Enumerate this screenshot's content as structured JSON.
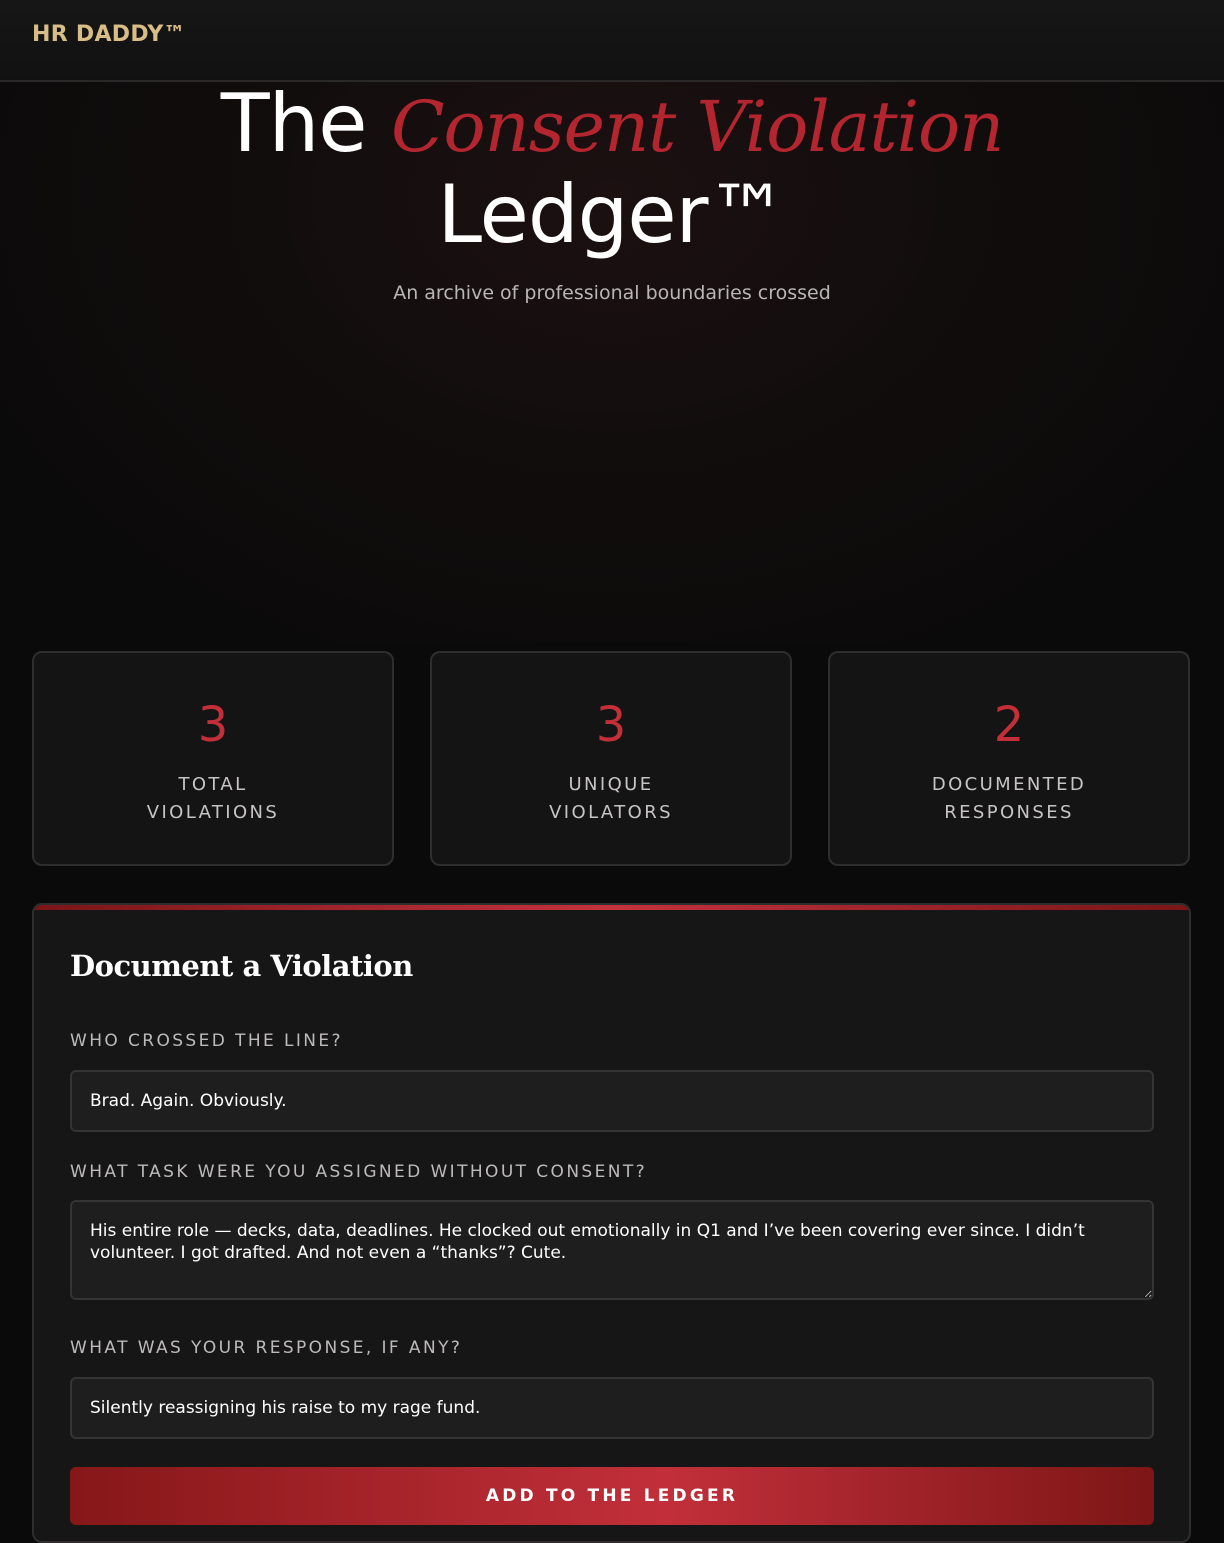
{
  "nav": {
    "brand": "HR DADDY™"
  },
  "hero": {
    "title_prefix": "The",
    "title_accent": "Consent Violation",
    "title_suffix": "Ledger™",
    "subtitle": "An archive of professional boundaries crossed"
  },
  "stats": [
    {
      "value": "3",
      "label": "TOTAL VIOLATIONS"
    },
    {
      "value": "3",
      "label": "UNIQUE VIOLATORS"
    },
    {
      "value": "2",
      "label": "DOCUMENTED RESPONSES"
    }
  ],
  "form": {
    "title": "Document a Violation",
    "violator": {
      "label": "WHO CROSSED THE LINE?",
      "value": "Brad. Again. Obviously."
    },
    "task": {
      "label": "WHAT TASK WERE YOU ASSIGNED WITHOUT CONSENT?",
      "value": "His entire role — decks, data, deadlines. He clocked out emotionally in Q1 and I’ve been covering ever since. I didn’t volunteer. I got drafted. And not even a “thanks”? Cute."
    },
    "response": {
      "label": "WHAT WAS YOUR RESPONSE, IF ANY?",
      "value": "Silently reassigning his raise to my rage fund."
    },
    "submit_label": "ADD TO THE LEDGER"
  },
  "colors": {
    "brand_gold": "#d8bd86",
    "accent_red": "#b3262f",
    "stat_red": "#c22f38",
    "background": "#0b0a0a"
  }
}
